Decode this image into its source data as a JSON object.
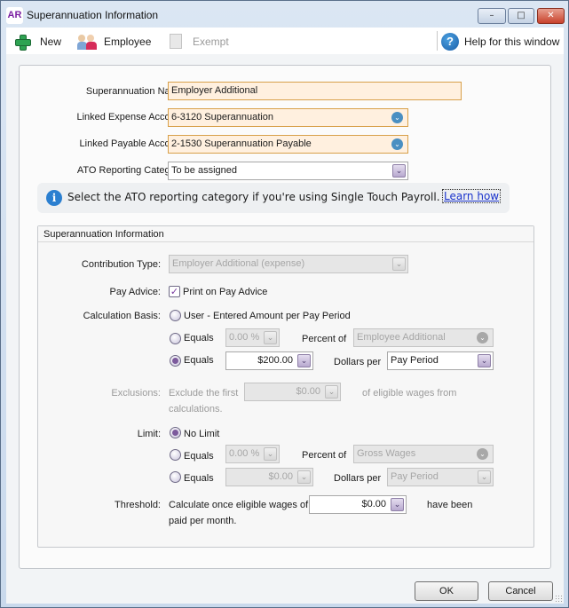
{
  "window": {
    "app_badge": "AR",
    "title": "Superannuation Information",
    "controls": {
      "minimize": "–",
      "maximize": "□",
      "close": "✕"
    }
  },
  "toolbar": {
    "new_label": "New",
    "employee_label": "Employee",
    "exempt_label": "Exempt",
    "help_label": "Help for this window",
    "help_glyph": "?"
  },
  "form": {
    "super_name": {
      "label": "Superannuation Name:",
      "value": "Employer Additional"
    },
    "expense_account": {
      "label": "Linked Expense Account:",
      "value": "6-3120 Superannuation"
    },
    "payable_account": {
      "label": "Linked Payable Account:",
      "value": "2-1530 Superannuation Payable"
    },
    "ato_category": {
      "label": "ATO Reporting Category:",
      "value": "To be assigned"
    }
  },
  "info": {
    "glyph": "i",
    "text": "Select the ATO reporting category if you're using Single Touch Payroll.",
    "link": "Learn how"
  },
  "group": {
    "title": "Superannuation Information",
    "contribution_type": {
      "label": "Contribution Type:",
      "value": "Employer Additional (expense)"
    },
    "pay_advice": {
      "label": "Pay Advice:",
      "checkbox_label": "Print on Pay Advice",
      "checked": true
    },
    "calc_basis": {
      "label": "Calculation Basis:",
      "option_user": "User - Entered Amount per Pay Period",
      "option_percent": {
        "label": "Equals",
        "value": "0.00 %",
        "of_label": "Percent of",
        "of_value": "Employee Additional"
      },
      "option_dollars": {
        "label": "Equals",
        "value": "$200.00",
        "per_label": "Dollars per",
        "per_value": "Pay Period"
      },
      "selected": "dollars"
    },
    "exclusions": {
      "label": "Exclusions:",
      "prefix": "Exclude the first",
      "value": "$0.00",
      "suffix": "of eligible wages from",
      "suffix2": "calculations."
    },
    "limit": {
      "label": "Limit:",
      "option_none": "No Limit",
      "option_percent": {
        "label": "Equals",
        "value": "0.00 %",
        "of_label": "Percent of",
        "of_value": "Gross Wages"
      },
      "option_dollars": {
        "label": "Equals",
        "value": "$0.00",
        "per_label": "Dollars per",
        "per_value": "Pay Period"
      },
      "selected": "none"
    },
    "threshold": {
      "label": "Threshold:",
      "prefix": "Calculate once eligible wages of",
      "value": "$0.00",
      "suffix": "have been",
      "suffix2": "paid per month."
    }
  },
  "buttons": {
    "ok": "OK",
    "cancel": "Cancel"
  },
  "icons": {
    "dropdown": "⌄",
    "check": "✓"
  }
}
